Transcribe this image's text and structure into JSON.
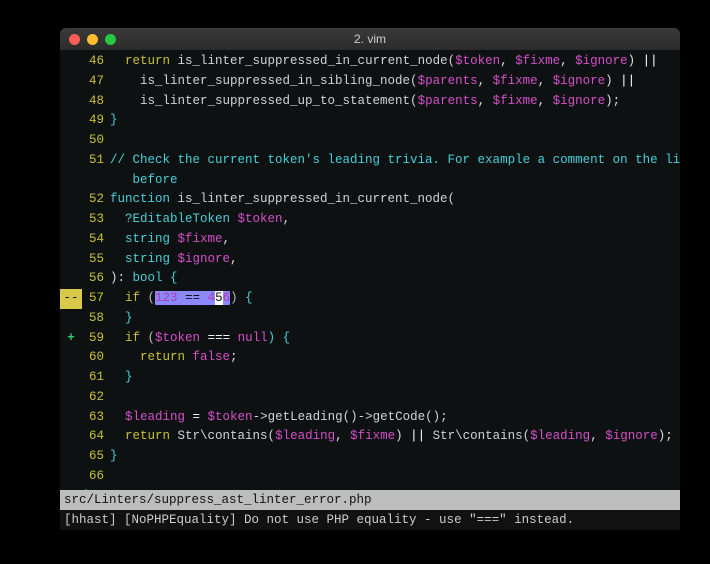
{
  "window": {
    "title": "2. vim"
  },
  "file": {
    "path": "src/Linters/suppress_ast_linter_error.php"
  },
  "lint_message": "[hhast] [NoPHPEquality] Do not use PHP equality - use \"===\" instead.",
  "lines": {
    "l46": {
      "num": "46",
      "indent": "  ",
      "kw": "return",
      "fn": " is_linter_suppressed_in_current_node(",
      "v1": "$token",
      "c1": ", ",
      "v2": "$fixme",
      "c2": ", ",
      "v3": "$ignore",
      "close": ") ",
      "pipe": "||"
    },
    "l47": {
      "num": "47",
      "indent": "    ",
      "fn": "is_linter_suppressed_in_sibling_node(",
      "v1": "$parents",
      "c1": ", ",
      "v2": "$fixme",
      "c2": ", ",
      "v3": "$ignore",
      "close": ") ",
      "pipe": "||"
    },
    "l48": {
      "num": "48",
      "indent": "    ",
      "fn": "is_linter_suppressed_up_to_statement(",
      "v1": "$parents",
      "c1": ", ",
      "v2": "$fixme",
      "c2": ", ",
      "v3": "$ignore",
      "close": ");"
    },
    "l49": {
      "num": "49",
      "brace": "}"
    },
    "l50": {
      "num": "50",
      "text": " "
    },
    "l51": {
      "num": "51",
      "comment": "// Check the current token's leading trivia. For example a comment on the line"
    },
    "l51b": {
      "indent": "   ",
      "comment": "before"
    },
    "l52": {
      "num": "52",
      "kw": "function",
      "fn": " is_linter_suppressed_in_current_node("
    },
    "l53": {
      "num": "53",
      "indent": "  ",
      "type": "?EditableToken ",
      "v": "$token",
      "c": ","
    },
    "l54": {
      "num": "54",
      "indent": "  ",
      "type": "string ",
      "v": "$fixme",
      "c": ","
    },
    "l55": {
      "num": "55",
      "indent": "  ",
      "type": "string ",
      "v": "$ignore",
      "c": ","
    },
    "l56": {
      "num": "56",
      "close": "): ",
      "type": "bool ",
      "brace": "{"
    },
    "l57": {
      "num": "57",
      "sign": "--",
      "indent": "  ",
      "kw": "if ",
      "p1": "(",
      "hl_n1": "123",
      "hl_op": " == ",
      "hl_n2a": "4",
      "hl_n2b": "5",
      "hl_n2c": "6",
      "p2": ")",
      "after": " {"
    },
    "l58": {
      "num": "58",
      "indent": "  ",
      "brace": "}"
    },
    "l59": {
      "num": "59",
      "sign": "+",
      "indent": "  ",
      "kw": "if ",
      "p1": "(",
      "v": "$token",
      "op": " === ",
      "null": "null",
      "p2": ") {"
    },
    "l60": {
      "num": "60",
      "indent": "    ",
      "kw": "return ",
      "bool": "false",
      "semi": ";"
    },
    "l61": {
      "num": "61",
      "indent": "  ",
      "brace": "}"
    },
    "l62": {
      "num": "62",
      "text": " "
    },
    "l63": {
      "num": "63",
      "indent": "  ",
      "v1": "$leading",
      "op": " = ",
      "v2": "$token",
      "arrow": "->getLeading()->getCode();"
    },
    "l64": {
      "num": "64",
      "indent": "  ",
      "kw": "return",
      "fn1": " Str\\contains(",
      "v1": "$leading",
      "c1": ", ",
      "v2": "$fixme",
      "mid": ") ",
      "pipe": "||",
      "fn2": " Str\\contains(",
      "v3": "$leading",
      "c2": ", ",
      "v4": "$ignore",
      "close": ");"
    },
    "l65": {
      "num": "65",
      "brace": "}"
    },
    "l66": {
      "num": "66",
      "text": " "
    },
    "at": {
      "text": "@"
    }
  }
}
